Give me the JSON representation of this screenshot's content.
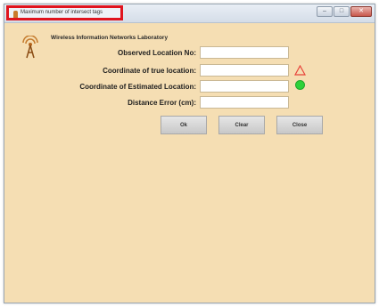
{
  "window": {
    "title": "Maximum number of intersect tags",
    "minimize_glyph": "–",
    "maximize_glyph": "□",
    "close_glyph": "✕"
  },
  "header": {
    "lab_name": "Wireless Information Networks Laboratory",
    "logo_icon": "antenna-tower-icon"
  },
  "form": {
    "observed_location_label": "Observed Location No:",
    "observed_location_value": "",
    "true_location_label": "Coordinate of true location:",
    "true_location_value": "",
    "estimated_location_label": "Coordinate of Estimated Location:",
    "estimated_location_value": "",
    "distance_error_label": "Distance Error (cm):",
    "distance_error_value": ""
  },
  "indicators": {
    "true_location_icon": "warning-triangle-icon",
    "true_location_color": "#e8433a",
    "estimated_location_icon": "green-dot-icon",
    "estimated_location_color": "#2ed13a"
  },
  "buttons": {
    "ok_label": "Ok",
    "clear_label": "Clear",
    "close_label": "Close"
  },
  "colors": {
    "background": "#f5deb3",
    "title_highlight": "#e0141e"
  }
}
